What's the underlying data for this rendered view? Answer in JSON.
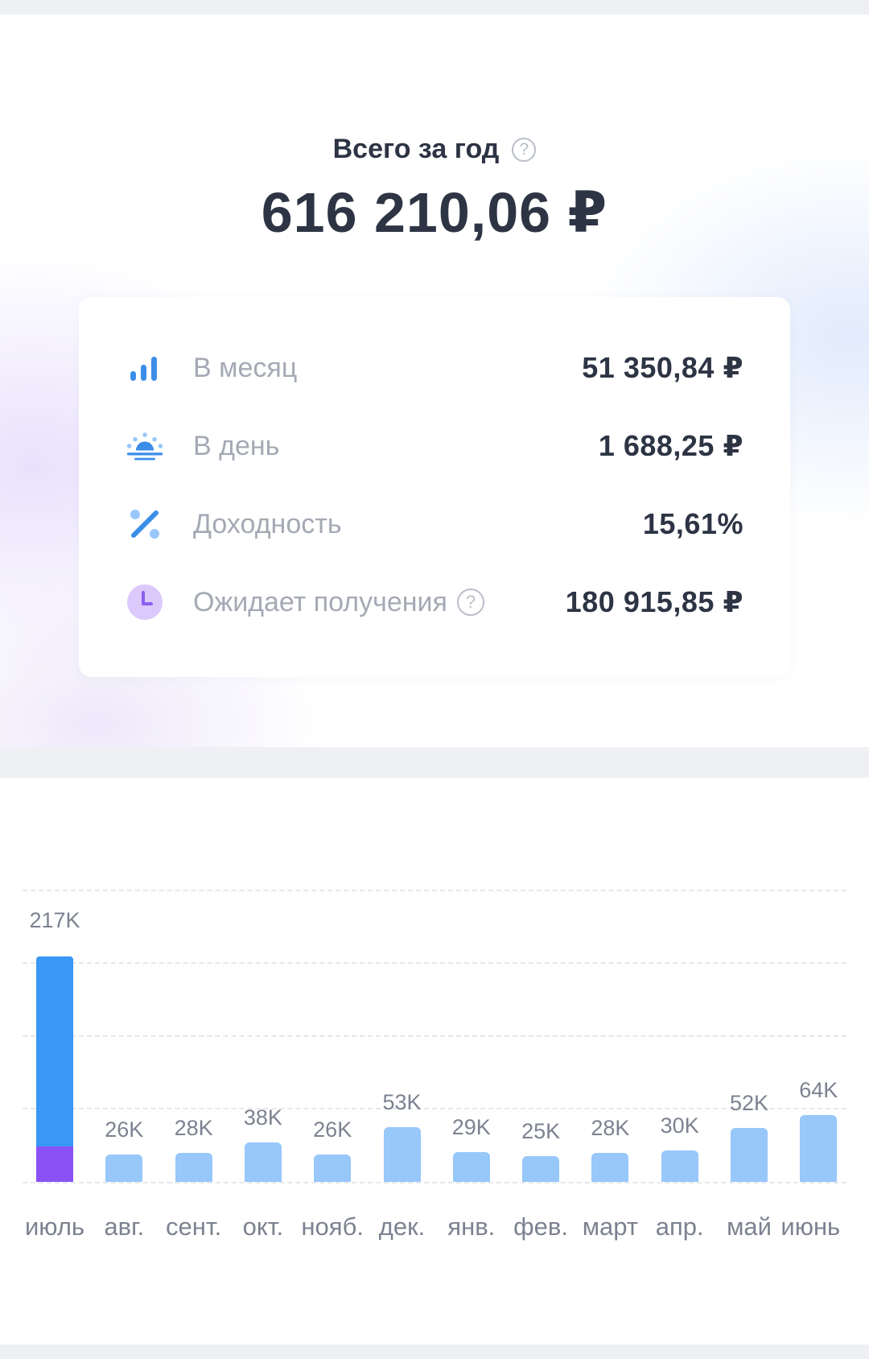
{
  "summary": {
    "title": "Всего за год",
    "help_glyph": "?",
    "total": "616 210,06 ₽",
    "rows": [
      {
        "icon": "bar-chart-icon",
        "label": "В месяц",
        "value": "51 350,84 ₽"
      },
      {
        "icon": "sunrise-icon",
        "label": "В день",
        "value": "1 688,25 ₽"
      },
      {
        "icon": "percent-icon",
        "label": "Доходность",
        "value": "15,61%"
      },
      {
        "icon": "clock-icon",
        "label": "Ожидает получения",
        "value": "180 915,85 ₽",
        "has_help": true
      }
    ]
  },
  "colors": {
    "text_primary": "#2d3444",
    "text_secondary": "#a4a9b4",
    "bar_highlight": "#3a97f6",
    "bar_highlight_lower": "#8a52f5",
    "bar_default": "#98c7fa",
    "accent_blue": "#3a8ee8",
    "accent_purple": "#8c5ef0"
  },
  "chart_data": {
    "type": "bar",
    "categories": [
      "июль",
      "авг.",
      "сент.",
      "окт.",
      "нояб.",
      "дек.",
      "янв.",
      "фев.",
      "март",
      "апр.",
      "май",
      "июнь"
    ],
    "value_labels": [
      "217K",
      "26K",
      "28K",
      "38K",
      "26K",
      "53K",
      "29K",
      "25K",
      "28K",
      "30K",
      "52K",
      "64K"
    ],
    "values": [
      217,
      26,
      28,
      38,
      26,
      53,
      29,
      25,
      28,
      30,
      52,
      64
    ],
    "highlight": {
      "index": 0,
      "lower_segment_value": 34
    },
    "ylim": [
      0,
      280
    ],
    "grid": true
  }
}
